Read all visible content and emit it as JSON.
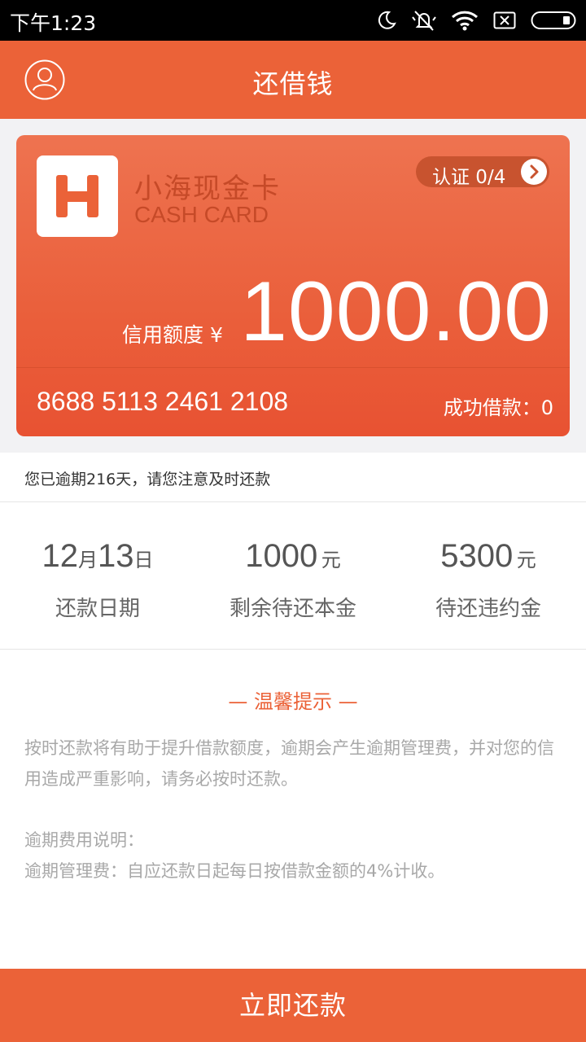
{
  "status_bar": {
    "time": "下午1:23",
    "icons": [
      "moon-icon",
      "mute-icon",
      "wifi-icon",
      "sim-x-icon",
      "battery-icon"
    ]
  },
  "header": {
    "title": "还借钱",
    "profile_icon": "user-circle-icon"
  },
  "card": {
    "logo_letter": "H",
    "name": "小海现金卡",
    "name_en": "CASH CARD",
    "verify_label": "认证 0/4",
    "credit_label": "信用额度 ¥",
    "credit_amount": "1000.00",
    "card_number": "8688 5113 2461 2108",
    "loan_count": "成功借款：0"
  },
  "overdue_notice": "您已逾期216天，请您注意及时还款",
  "stats": {
    "due_date": {
      "month": "12",
      "month_unit": "月",
      "day": "13",
      "day_unit": "日",
      "label": "还款日期"
    },
    "principal": {
      "value": "1000",
      "unit": "元",
      "label": "剩余待还本金"
    },
    "penalty": {
      "value": "5300",
      "unit": "元",
      "label": "待还违约金"
    }
  },
  "tips": {
    "title": "— 温馨提示 —",
    "body": "按时还款将有助于提升借款额度，逾期会产生逾期管理费，并对您的信用造成严重影响，请务必按时还款。",
    "note_title": "逾期费用说明：",
    "note_body": "逾期管理费：自应还款日起每日按借款金额的4%计收。"
  },
  "footer": {
    "repay_label": "立即还款"
  },
  "colors": {
    "brand": "#EB6238",
    "status_bar": "#000000",
    "tip_text": "#A8A8A8"
  }
}
